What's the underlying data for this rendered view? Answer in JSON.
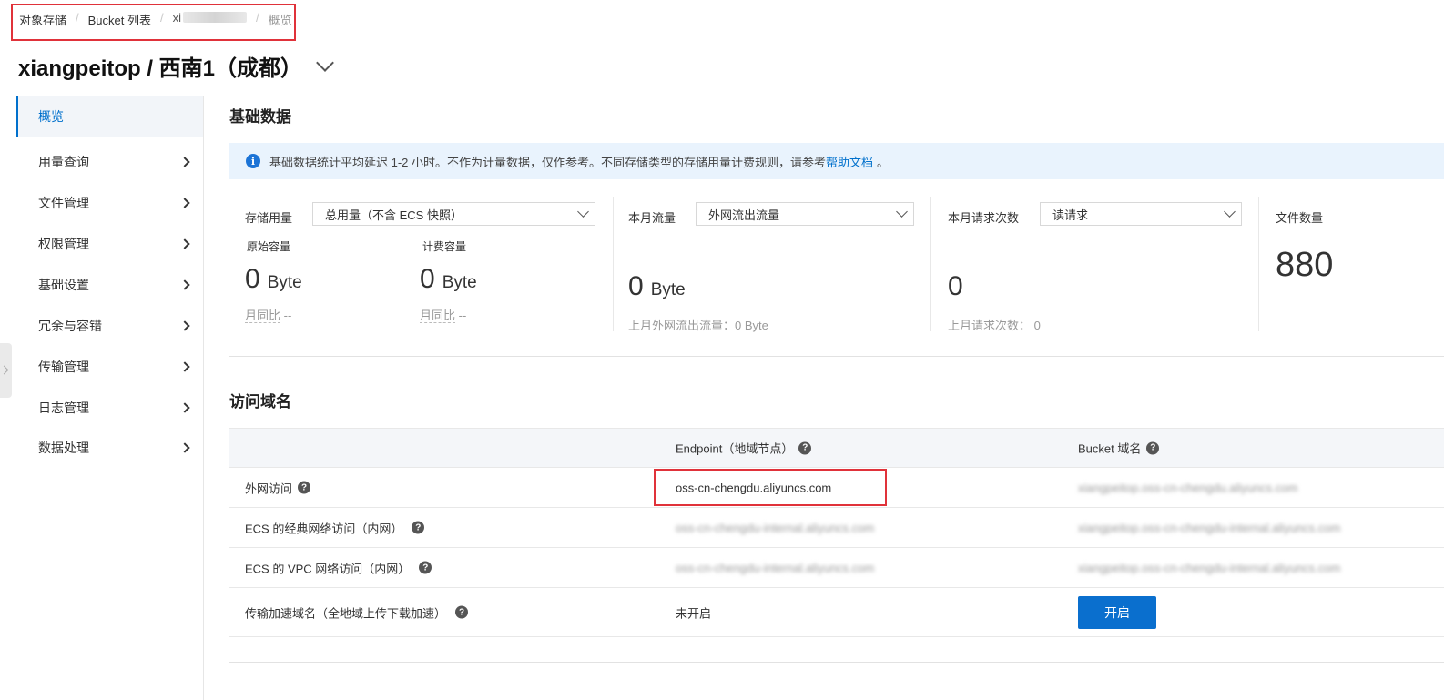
{
  "breadcrumb": {
    "items": [
      "对象存储",
      "Bucket 列表",
      "xi",
      "概览"
    ]
  },
  "header": {
    "title": "xiangpeitop / 西南1（成都）"
  },
  "sidebar": {
    "items": [
      {
        "label": "概览",
        "active": true
      },
      {
        "label": "用量查询"
      },
      {
        "label": "文件管理"
      },
      {
        "label": "权限管理"
      },
      {
        "label": "基础设置"
      },
      {
        "label": "冗余与容错"
      },
      {
        "label": "传输管理"
      },
      {
        "label": "日志管理"
      },
      {
        "label": "数据处理"
      }
    ]
  },
  "basic_data": {
    "title": "基础数据",
    "notice_text": "基础数据统计平均延迟 1-2 小时。不作为计量数据，仅作参考。不同存储类型的存储用量计费规则，请参考",
    "notice_link": "帮助文档",
    "notice_end": "。",
    "storage": {
      "label": "存储用量",
      "select": "总用量（不含 ECS 快照）",
      "raw_label": "原始容量",
      "raw_value": "0",
      "raw_unit": "Byte",
      "raw_mom": "月同比",
      "raw_mom_value": "--",
      "billed_label": "计费容量",
      "billed_value": "0",
      "billed_unit": "Byte",
      "billed_mom": "月同比",
      "billed_mom_value": "--"
    },
    "traffic": {
      "label": "本月流量",
      "select": "外网流出流量",
      "value": "0",
      "unit": "Byte",
      "last_month": "上月外网流出流量：0 Byte"
    },
    "requests": {
      "label": "本月请求次数",
      "select": "读请求",
      "value": "0",
      "last_month": "上月请求次数：  0"
    },
    "files": {
      "label": "文件数量",
      "value": "880"
    }
  },
  "domains": {
    "title": "访问域名",
    "col_endpoint": "Endpoint（地域节点）",
    "col_bucket": "Bucket 域名",
    "rows": [
      {
        "name": "外网访问",
        "endpoint": "oss-cn-chengdu.aliyuncs.com",
        "bucket": "xiangpeitop.oss-cn-chengdu.aliyuncs.com"
      },
      {
        "name": "ECS 的经典网络访问（内网）",
        "endpoint": "oss-cn-chengdu-internal.aliyuncs.com",
        "bucket": "xiangpeitop.oss-cn-chengdu-internal.aliyuncs.com"
      },
      {
        "name": "ECS 的 VPC 网络访问（内网）",
        "endpoint": "oss-cn-chengdu-internal.aliyuncs.com",
        "bucket": "xiangpeitop.oss-cn-chengdu-internal.aliyuncs.com"
      },
      {
        "name": "传输加速域名（全地域上传下载加速）",
        "endpoint": "未开启",
        "button": "开启"
      }
    ]
  },
  "icons": {
    "info": "i",
    "help": "?"
  },
  "colors": {
    "accent": "#0070cc",
    "highlight_border": "#e0323a",
    "notice_bg": "#e9f3fd",
    "button_bg": "#0a6fce"
  }
}
